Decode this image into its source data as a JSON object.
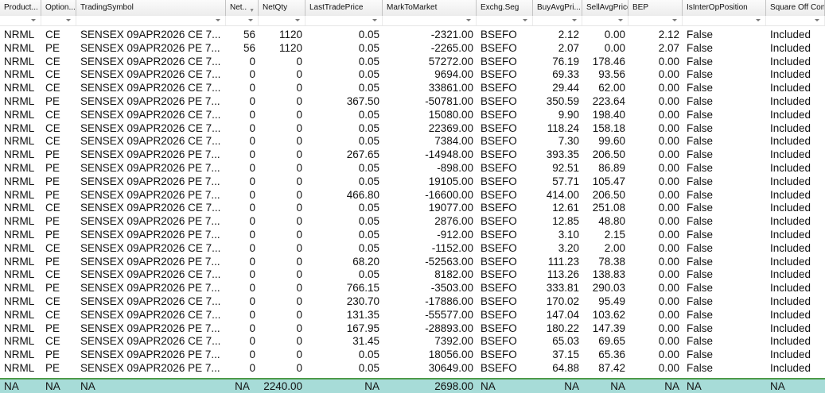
{
  "columns": [
    "Product...",
    "Option...",
    "TradingSymbol",
    "Net..",
    "NetQty",
    "LastTradePrice",
    "MarkToMarket",
    "Exchg.Seg",
    "BuyAvgPri...",
    "SellAvgPrice",
    "BEP",
    "IsInterOpPosition",
    "Square Off Con"
  ],
  "rows": [
    [
      "NRML",
      "CE",
      "SENSEX 09APR2026 CE 7...",
      "56",
      "1120",
      "0.05",
      "-2321.00",
      "BSEFO",
      "2.12",
      "0.00",
      "2.12",
      "False",
      "Included"
    ],
    [
      "NRML",
      "PE",
      "SENSEX 09APR2026 PE 7...",
      "56",
      "1120",
      "0.05",
      "-2265.00",
      "BSEFO",
      "2.07",
      "0.00",
      "2.07",
      "False",
      "Included"
    ],
    [
      "NRML",
      "CE",
      "SENSEX 09APR2026 CE 7...",
      "0",
      "0",
      "0.05",
      "57272.00",
      "BSEFO",
      "76.19",
      "178.46",
      "0.00",
      "False",
      "Included"
    ],
    [
      "NRML",
      "CE",
      "SENSEX 09APR2026 CE 7...",
      "0",
      "0",
      "0.05",
      "9694.00",
      "BSEFO",
      "69.33",
      "93.56",
      "0.00",
      "False",
      "Included"
    ],
    [
      "NRML",
      "CE",
      "SENSEX 09APR2026 CE 7...",
      "0",
      "0",
      "0.05",
      "33861.00",
      "BSEFO",
      "29.44",
      "62.00",
      "0.00",
      "False",
      "Included"
    ],
    [
      "NRML",
      "PE",
      "SENSEX 09APR2026 PE 7...",
      "0",
      "0",
      "367.50",
      "-50781.00",
      "BSEFO",
      "350.59",
      "223.64",
      "0.00",
      "False",
      "Included"
    ],
    [
      "NRML",
      "CE",
      "SENSEX 09APR2026 CE 7...",
      "0",
      "0",
      "0.05",
      "15080.00",
      "BSEFO",
      "9.90",
      "198.40",
      "0.00",
      "False",
      "Included"
    ],
    [
      "NRML",
      "CE",
      "SENSEX 09APR2026 CE 7...",
      "0",
      "0",
      "0.05",
      "22369.00",
      "BSEFO",
      "118.24",
      "158.18",
      "0.00",
      "False",
      "Included"
    ],
    [
      "NRML",
      "CE",
      "SENSEX 09APR2026 CE 7...",
      "0",
      "0",
      "0.05",
      "7384.00",
      "BSEFO",
      "7.30",
      "99.60",
      "0.00",
      "False",
      "Included"
    ],
    [
      "NRML",
      "PE",
      "SENSEX 09APR2026 PE 7...",
      "0",
      "0",
      "267.65",
      "-14948.00",
      "BSEFO",
      "393.35",
      "206.50",
      "0.00",
      "False",
      "Included"
    ],
    [
      "NRML",
      "PE",
      "SENSEX 09APR2026 PE 7...",
      "0",
      "0",
      "0.05",
      "-898.00",
      "BSEFO",
      "92.51",
      "86.89",
      "0.00",
      "False",
      "Included"
    ],
    [
      "NRML",
      "PE",
      "SENSEX 09APR2026 PE 7...",
      "0",
      "0",
      "0.05",
      "19105.00",
      "BSEFO",
      "57.71",
      "105.47",
      "0.00",
      "False",
      "Included"
    ],
    [
      "NRML",
      "PE",
      "SENSEX 09APR2026 PE 7...",
      "0",
      "0",
      "466.80",
      "-16600.00",
      "BSEFO",
      "414.00",
      "206.50",
      "0.00",
      "False",
      "Included"
    ],
    [
      "NRML",
      "CE",
      "SENSEX 09APR2026 CE 7...",
      "0",
      "0",
      "0.05",
      "19077.00",
      "BSEFO",
      "12.61",
      "251.08",
      "0.00",
      "False",
      "Included"
    ],
    [
      "NRML",
      "PE",
      "SENSEX 09APR2026 PE 7...",
      "0",
      "0",
      "0.05",
      "2876.00",
      "BSEFO",
      "12.85",
      "48.80",
      "0.00",
      "False",
      "Included"
    ],
    [
      "NRML",
      "PE",
      "SENSEX 09APR2026 PE 7...",
      "0",
      "0",
      "0.05",
      "-912.00",
      "BSEFO",
      "3.10",
      "2.15",
      "0.00",
      "False",
      "Included"
    ],
    [
      "NRML",
      "CE",
      "SENSEX 09APR2026 CE 7...",
      "0",
      "0",
      "0.05",
      "-1152.00",
      "BSEFO",
      "3.20",
      "2.00",
      "0.00",
      "False",
      "Included"
    ],
    [
      "NRML",
      "PE",
      "SENSEX 09APR2026 PE 7...",
      "0",
      "0",
      "68.20",
      "-52563.00",
      "BSEFO",
      "111.23",
      "78.38",
      "0.00",
      "False",
      "Included"
    ],
    [
      "NRML",
      "CE",
      "SENSEX 09APR2026 CE 7...",
      "0",
      "0",
      "0.05",
      "8182.00",
      "BSEFO",
      "113.26",
      "138.83",
      "0.00",
      "False",
      "Included"
    ],
    [
      "NRML",
      "PE",
      "SENSEX 09APR2026 PE 7...",
      "0",
      "0",
      "766.15",
      "-3503.00",
      "BSEFO",
      "333.81",
      "290.03",
      "0.00",
      "False",
      "Included"
    ],
    [
      "NRML",
      "CE",
      "SENSEX 09APR2026 CE 7...",
      "0",
      "0",
      "230.70",
      "-17886.00",
      "BSEFO",
      "170.02",
      "95.49",
      "0.00",
      "False",
      "Included"
    ],
    [
      "NRML",
      "CE",
      "SENSEX 09APR2026 CE 7...",
      "0",
      "0",
      "131.35",
      "-55577.00",
      "BSEFO",
      "147.04",
      "103.62",
      "0.00",
      "False",
      "Included"
    ],
    [
      "NRML",
      "PE",
      "SENSEX 09APR2026 PE 7...",
      "0",
      "0",
      "167.95",
      "-28893.00",
      "BSEFO",
      "180.22",
      "147.39",
      "0.00",
      "False",
      "Included"
    ],
    [
      "NRML",
      "CE",
      "SENSEX 09APR2026 CE 7...",
      "0",
      "0",
      "31.45",
      "7392.00",
      "BSEFO",
      "65.03",
      "69.65",
      "0.00",
      "False",
      "Included"
    ],
    [
      "NRML",
      "PE",
      "SENSEX 09APR2026 PE 7...",
      "0",
      "0",
      "0.05",
      "18056.00",
      "BSEFO",
      "37.15",
      "65.36",
      "0.00",
      "False",
      "Included"
    ],
    [
      "NRML",
      "PE",
      "SENSEX 09APR2026 PE 7...",
      "0",
      "0",
      "0.05",
      "30649.00",
      "BSEFO",
      "64.88",
      "87.42",
      "0.00",
      "False",
      "Included"
    ]
  ],
  "totals": [
    "NA",
    "NA",
    "NA",
    "NA",
    "2240.00",
    "NA",
    "2698.00",
    "NA",
    "NA",
    "NA",
    "NA",
    "NA",
    "NA"
  ]
}
